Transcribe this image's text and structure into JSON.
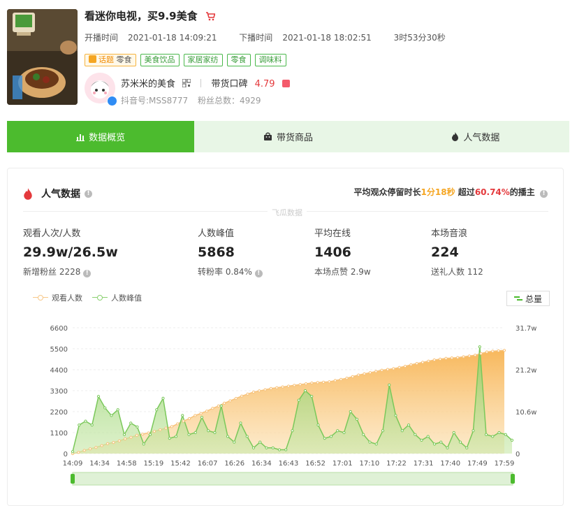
{
  "stream": {
    "title": "看迷你电视，买9.9美食",
    "start_label": "开播时间",
    "start_time": "2021-01-18 14:09:21",
    "end_label": "下播时间",
    "end_time": "2021-01-18 18:02:51",
    "duration": "3时53分30秒",
    "topic_label": "话题",
    "topic_value": "零食",
    "tags": [
      "美食饮品",
      "家居家纺",
      "零食",
      "调味料"
    ]
  },
  "anchor": {
    "name": "苏米米的美食",
    "reputation_label": "带货口碑",
    "reputation_score": "4.79",
    "douyin_id": "抖音号:MSS8777",
    "fans": "粉丝总数：4929"
  },
  "tabs": [
    {
      "label": "数据概览",
      "icon": "bar-chart-icon",
      "active": true
    },
    {
      "label": "带货商品",
      "icon": "shopping-bag-icon",
      "active": false
    },
    {
      "label": "人气数据",
      "icon": "flame-icon",
      "active": false
    }
  ],
  "popularity": {
    "title": "人气数据",
    "avg_prefix": "平均观众停留时长",
    "avg_time": "1分18秒",
    "avg_mid": "超过",
    "avg_percent": "60.74%",
    "avg_suffix": "的播主",
    "watermark": "飞瓜数据",
    "stats": [
      {
        "label": "观看人次/人数",
        "value": "29.9w/26.5w",
        "extra": "新增粉丝 2228"
      },
      {
        "label": "人数峰值",
        "value": "5868",
        "extra": "转粉率 0.84%"
      },
      {
        "label": "平均在线",
        "value": "1406",
        "extra": "本场点赞 2.9w"
      },
      {
        "label": "本场音浪",
        "value": "224",
        "extra": "送礼人数 112"
      }
    ],
    "total_button": "总量"
  },
  "colors": {
    "accent": "#4cbb2e",
    "orange": "#f5a623",
    "red": "#e4393c"
  },
  "chart_data": {
    "type": "area",
    "x": [
      "14:09",
      "14:34",
      "14:58",
      "15:19",
      "15:42",
      "16:07",
      "16:26",
      "16:34",
      "16:43",
      "16:52",
      "17:01",
      "17:10",
      "17:22",
      "17:31",
      "17:40",
      "17:49",
      "17:59"
    ],
    "left_ticks": [
      "0",
      "1100",
      "2200",
      "3300",
      "4400",
      "5500",
      "6600"
    ],
    "right_ticks": [
      "0",
      "10.6w",
      "21.2w",
      "31.7w"
    ],
    "left_ylim": [
      0,
      6600
    ],
    "right_ylim": [
      0,
      317000
    ],
    "series": [
      {
        "name": "观看人数",
        "axis": "right",
        "color": "#f5a623",
        "values": [
          0,
          3000,
          8000,
          12000,
          15500,
          20000,
          25000,
          28000,
          32000,
          37000,
          41000,
          46000,
          49000,
          52000,
          56000,
          60000,
          64000,
          68000,
          75000,
          82000,
          88000,
          96000,
          101000,
          107000,
          114000,
          120000,
          127000,
          133000,
          139000,
          145000,
          150000,
          155000,
          158000,
          161000,
          164000,
          166000,
          168000,
          170000,
          172000,
          174000,
          176000,
          178000,
          179000,
          180000,
          181000,
          184000,
          187000,
          190000,
          194000,
          198000,
          201000,
          204000,
          207000,
          210000,
          212000,
          214000,
          217000,
          220000,
          224000,
          227000,
          230000,
          233000,
          236000,
          238000,
          240000,
          241000,
          242000,
          244000,
          246000,
          248000,
          252000,
          256000,
          258000,
          259000,
          260000
        ]
      },
      {
        "name": "人数峰值",
        "axis": "left",
        "color": "#8ad16f",
        "values": [
          100,
          1500,
          1700,
          1500,
          3000,
          2400,
          2000,
          2300,
          1000,
          1600,
          1400,
          500,
          1000,
          2300,
          2900,
          800,
          900,
          2000,
          1000,
          1100,
          1900,
          1200,
          1100,
          2500,
          900,
          600,
          1600,
          900,
          300,
          600,
          300,
          300,
          200,
          200,
          1200,
          2800,
          3300,
          3000,
          1500,
          800,
          900,
          1200,
          1100,
          2200,
          1800,
          1000,
          600,
          500,
          1200,
          3600,
          2000,
          1200,
          1500,
          1000,
          700,
          900,
          500,
          600,
          300,
          1100,
          600,
          300,
          1200,
          5600,
          1000,
          900,
          1100,
          1000,
          700
        ]
      }
    ]
  }
}
